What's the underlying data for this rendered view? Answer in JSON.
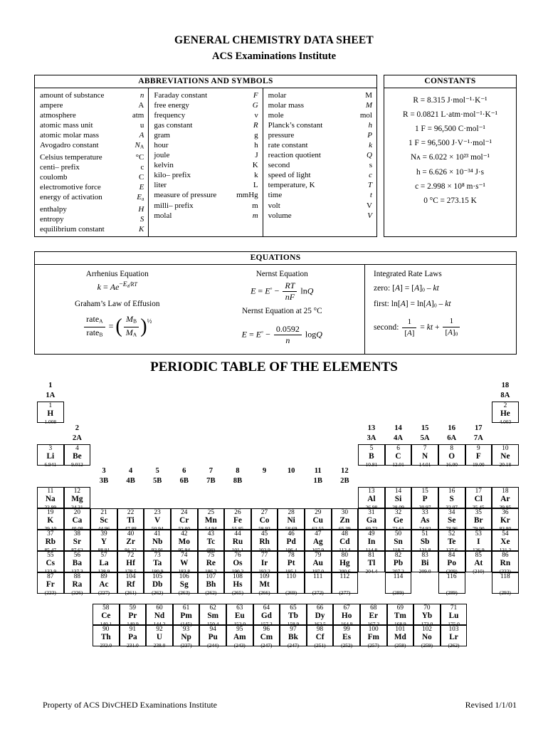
{
  "header": {
    "title": "GENERAL CHEMISTRY DATA SHEET",
    "subtitle": "ACS Examinations Institute"
  },
  "abbreviations": {
    "heading": "ABBREVIATIONS AND SYMBOLS",
    "columns": [
      [
        {
          "name": "amount of substance",
          "symbol": "n",
          "italic": true
        },
        {
          "name": "ampere",
          "symbol": "A",
          "italic": false
        },
        {
          "name": "atmosphere",
          "symbol": "atm",
          "italic": false
        },
        {
          "name": "atomic mass unit",
          "symbol": "u",
          "italic": false
        },
        {
          "name": "atomic molar mass",
          "symbol": "A",
          "italic": true
        },
        {
          "name": "Avogadro constant",
          "symbol": "N",
          "sub": "A",
          "italic": true
        },
        {
          "name": "Celsius temperature",
          "symbol": "°C",
          "italic": false
        },
        {
          "name": "centi– prefix",
          "symbol": "c",
          "italic": false
        },
        {
          "name": "coulomb",
          "symbol": "C",
          "italic": false
        },
        {
          "name": "electromotive force",
          "symbol": "E",
          "italic": true
        },
        {
          "name": "energy of activation",
          "symbol": "E",
          "sub": "a",
          "italic": true
        },
        {
          "name": "enthalpy",
          "symbol": "H",
          "italic": true
        },
        {
          "name": "entropy",
          "symbol": "S",
          "italic": true
        },
        {
          "name": "equilibrium constant",
          "symbol": "K",
          "italic": true
        }
      ],
      [
        {
          "name": "Faraday constant",
          "symbol": "F",
          "italic": true
        },
        {
          "name": "free energy",
          "symbol": "G",
          "italic": true
        },
        {
          "name": "frequency",
          "symbol": "ν",
          "italic": false
        },
        {
          "name": "gas constant",
          "symbol": "R",
          "italic": true
        },
        {
          "name": "gram",
          "symbol": "g",
          "italic": false
        },
        {
          "name": "hour",
          "symbol": "h",
          "italic": false
        },
        {
          "name": "joule",
          "symbol": "J",
          "italic": false
        },
        {
          "name": "kelvin",
          "symbol": "K",
          "italic": false
        },
        {
          "name": "kilo– prefix",
          "symbol": "k",
          "italic": false
        },
        {
          "name": "liter",
          "symbol": "L",
          "italic": false
        },
        {
          "name": "measure of pressure",
          "symbol": "mmHg",
          "italic": false
        },
        {
          "name": "milli– prefix",
          "symbol": "m",
          "italic": false
        },
        {
          "name": "molal",
          "symbol": "m",
          "italic": true
        }
      ],
      [
        {
          "name": "molar",
          "symbol": "M",
          "italic": false
        },
        {
          "name": "molar mass",
          "symbol": "M",
          "italic": true
        },
        {
          "name": "mole",
          "symbol": "mol",
          "italic": false
        },
        {
          "name": "Planck’s constant",
          "symbol": "h",
          "italic": true
        },
        {
          "name": "pressure",
          "symbol": "P",
          "italic": true
        },
        {
          "name": "rate constant",
          "symbol": "k",
          "italic": true
        },
        {
          "name": "reaction quotient",
          "symbol": "Q",
          "italic": true
        },
        {
          "name": "second",
          "symbol": "s",
          "italic": false
        },
        {
          "name": "speed of light",
          "symbol": "c",
          "italic": true
        },
        {
          "name": "temperature, K",
          "symbol": "T",
          "italic": true
        },
        {
          "name": "time",
          "symbol": "t",
          "italic": true
        },
        {
          "name": "volt",
          "symbol": "V",
          "italic": false
        },
        {
          "name": "volume",
          "symbol": "V",
          "italic": true
        }
      ]
    ]
  },
  "constants": {
    "heading": "CONSTANTS",
    "lines": [
      "R = 8.315 J·mol⁻¹·K⁻¹",
      "R = 0.0821 L·atm·mol⁻¹·K⁻¹",
      "1 F = 96,500 C·mol⁻¹",
      "1 F = 96,500 J·V⁻¹·mol⁻¹",
      "Nᴀ = 6.022 × 10²³ mol⁻¹",
      "h = 6.626 × 10⁻³⁴ J·s",
      "c = 2.998 × 10⁸ m·s⁻¹",
      "0 °C = 273.15 K"
    ]
  },
  "equations": {
    "heading": "EQUATIONS",
    "arrhenius_label": "Arrhenius Equation",
    "arrhenius_formula": "k = Ae^(-Ea/RT)",
    "grahams_label": "Graham’s Law of Effusion",
    "grahams_formula": "rateA/rateB = (MB/MA)^(1/2)",
    "nernst_label": "Nernst Equation",
    "nernst_formula": "E = E° - (RT/nF) ln Q",
    "nernst25_label": "Nernst Equation at 25 °C",
    "nernst25_formula": "E = E° - (0.0592/n) log Q",
    "rate_laws_label": "Integrated Rate Laws",
    "rate_zero": "zero:  [A] = [A]₀ – kt",
    "rate_first": "first:  ln[A] = ln[A]₀ – kt",
    "rate_second": "second:  1/[A] = kt + 1/[A]₀",
    "rate_zero_prefix": "zero:",
    "rate_first_prefix": "first:",
    "rate_second_prefix": "second:"
  },
  "periodic_table": {
    "title": "PERIODIC TABLE OF THE ELEMENTS",
    "group_labels": [
      {
        "num": "1",
        "letter": "1A"
      },
      {
        "num": "2",
        "letter": "2A"
      },
      {
        "num": "3",
        "letter": "3B"
      },
      {
        "num": "4",
        "letter": "4B"
      },
      {
        "num": "5",
        "letter": "5B"
      },
      {
        "num": "6",
        "letter": "6B"
      },
      {
        "num": "7",
        "letter": "7B"
      },
      {
        "num": "8",
        "letter": "8B"
      },
      {
        "num": "9",
        "letter": ""
      },
      {
        "num": "10",
        "letter": ""
      },
      {
        "num": "11",
        "letter": "1B"
      },
      {
        "num": "12",
        "letter": "2B"
      },
      {
        "num": "13",
        "letter": "3A"
      },
      {
        "num": "14",
        "letter": "4A"
      },
      {
        "num": "15",
        "letter": "5A"
      },
      {
        "num": "16",
        "letter": "6A"
      },
      {
        "num": "17",
        "letter": "7A"
      },
      {
        "num": "18",
        "letter": "8A"
      }
    ],
    "elements": {
      "H": {
        "z": "1",
        "sym": "H",
        "mass": "1.008"
      },
      "He": {
        "z": "2",
        "sym": "He",
        "mass": "4.003"
      },
      "Li": {
        "z": "3",
        "sym": "Li",
        "mass": "6.941"
      },
      "Be": {
        "z": "4",
        "sym": "Be",
        "mass": "9.012"
      },
      "B": {
        "z": "5",
        "sym": "B",
        "mass": "10.81"
      },
      "C": {
        "z": "6",
        "sym": "C",
        "mass": "12.01"
      },
      "N": {
        "z": "7",
        "sym": "N",
        "mass": "14.01"
      },
      "O": {
        "z": "8",
        "sym": "O",
        "mass": "16.00"
      },
      "F": {
        "z": "9",
        "sym": "F",
        "mass": "19.00"
      },
      "Ne": {
        "z": "10",
        "sym": "Ne",
        "mass": "20.18"
      },
      "Na": {
        "z": "11",
        "sym": "Na",
        "mass": "22.99"
      },
      "Mg": {
        "z": "12",
        "sym": "Mg",
        "mass": "24.31"
      },
      "Al": {
        "z": "13",
        "sym": "Al",
        "mass": "26.98"
      },
      "Si": {
        "z": "14",
        "sym": "Si",
        "mass": "28.09"
      },
      "P": {
        "z": "15",
        "sym": "P",
        "mass": "30.97"
      },
      "S": {
        "z": "16",
        "sym": "S",
        "mass": "32.07"
      },
      "Cl": {
        "z": "17",
        "sym": "Cl",
        "mass": "35.45"
      },
      "Ar": {
        "z": "18",
        "sym": "Ar",
        "mass": "39.95"
      },
      "K": {
        "z": "19",
        "sym": "K",
        "mass": "39.10"
      },
      "Ca": {
        "z": "20",
        "sym": "Ca",
        "mass": "40.08"
      },
      "Sc": {
        "z": "21",
        "sym": "Sc",
        "mass": "44.96"
      },
      "Ti": {
        "z": "22",
        "sym": "Ti",
        "mass": "47.88"
      },
      "V": {
        "z": "23",
        "sym": "V",
        "mass": "50.94"
      },
      "Cr": {
        "z": "24",
        "sym": "Cr",
        "mass": "52.00"
      },
      "Mn": {
        "z": "25",
        "sym": "Mn",
        "mass": "54.94"
      },
      "Fe": {
        "z": "26",
        "sym": "Fe",
        "mass": "55.85"
      },
      "Co": {
        "z": "27",
        "sym": "Co",
        "mass": "58.93"
      },
      "Ni": {
        "z": "28",
        "sym": "Ni",
        "mass": "58.69"
      },
      "Cu": {
        "z": "29",
        "sym": "Cu",
        "mass": "63.55"
      },
      "Zn": {
        "z": "30",
        "sym": "Zn",
        "mass": "65.39"
      },
      "Ga": {
        "z": "31",
        "sym": "Ga",
        "mass": "69.72"
      },
      "Ge": {
        "z": "32",
        "sym": "Ge",
        "mass": "72.61"
      },
      "As": {
        "z": "33",
        "sym": "As",
        "mass": "74.92"
      },
      "Se": {
        "z": "34",
        "sym": "Se",
        "mass": "78.96"
      },
      "Br": {
        "z": "35",
        "sym": "Br",
        "mass": "79.90"
      },
      "Kr": {
        "z": "36",
        "sym": "Kr",
        "mass": "83.80"
      },
      "Rb": {
        "z": "37",
        "sym": "Rb",
        "mass": "85.47"
      },
      "Sr": {
        "z": "38",
        "sym": "Sr",
        "mass": "87.62"
      },
      "Y": {
        "z": "39",
        "sym": "Y",
        "mass": "88.91"
      },
      "Zr": {
        "z": "40",
        "sym": "Zr",
        "mass": "91.22"
      },
      "Nb": {
        "z": "41",
        "sym": "Nb",
        "mass": "92.91"
      },
      "Mo": {
        "z": "42",
        "sym": "Mo",
        "mass": "95.94"
      },
      "Tc": {
        "z": "43",
        "sym": "Tc",
        "mass": "(98)"
      },
      "Ru": {
        "z": "44",
        "sym": "Ru",
        "mass": "101.1"
      },
      "Rh": {
        "z": "45",
        "sym": "Rh",
        "mass": "102.9"
      },
      "Pd": {
        "z": "46",
        "sym": "Pd",
        "mass": "106.4"
      },
      "Ag": {
        "z": "47",
        "sym": "Ag",
        "mass": "107.9"
      },
      "Cd": {
        "z": "48",
        "sym": "Cd",
        "mass": "112.4"
      },
      "In": {
        "z": "49",
        "sym": "In",
        "mass": "114.8"
      },
      "Sn": {
        "z": "50",
        "sym": "Sn",
        "mass": "118.7"
      },
      "Sb": {
        "z": "51",
        "sym": "Sb",
        "mass": "121.8"
      },
      "Te": {
        "z": "52",
        "sym": "Te",
        "mass": "127.6"
      },
      "I": {
        "z": "53",
        "sym": "I",
        "mass": "126.9"
      },
      "Xe": {
        "z": "54",
        "sym": "Xe",
        "mass": "131.3"
      },
      "Cs": {
        "z": "55",
        "sym": "Cs",
        "mass": "132.9"
      },
      "Ba": {
        "z": "56",
        "sym": "Ba",
        "mass": "137.3"
      },
      "La": {
        "z": "57",
        "sym": "La",
        "mass": "138.9"
      },
      "Hf": {
        "z": "72",
        "sym": "Hf",
        "mass": "178.5"
      },
      "Ta": {
        "z": "73",
        "sym": "Ta",
        "mass": "180.9"
      },
      "W": {
        "z": "74",
        "sym": "W",
        "mass": "183.8"
      },
      "Re": {
        "z": "75",
        "sym": "Re",
        "mass": "186.2"
      },
      "Os": {
        "z": "76",
        "sym": "Os",
        "mass": "190.2"
      },
      "Ir": {
        "z": "77",
        "sym": "Ir",
        "mass": "192.2"
      },
      "Pt": {
        "z": "78",
        "sym": "Pt",
        "mass": "195.1"
      },
      "Au": {
        "z": "79",
        "sym": "Au",
        "mass": "197.0"
      },
      "Hg": {
        "z": "80",
        "sym": "Hg",
        "mass": "200.6"
      },
      "Tl": {
        "z": "81",
        "sym": "Tl",
        "mass": "204.4"
      },
      "Pb": {
        "z": "82",
        "sym": "Pb",
        "mass": "207.2"
      },
      "Bi": {
        "z": "83",
        "sym": "Bi",
        "mass": "209.0"
      },
      "Po": {
        "z": "84",
        "sym": "Po",
        "mass": "(209)"
      },
      "At": {
        "z": "85",
        "sym": "At",
        "mass": "(210)"
      },
      "Rn": {
        "z": "86",
        "sym": "Rn",
        "mass": "(222)"
      },
      "Fr": {
        "z": "87",
        "sym": "Fr",
        "mass": "(223)"
      },
      "Ra": {
        "z": "88",
        "sym": "Ra",
        "mass": "(226)"
      },
      "Ac": {
        "z": "89",
        "sym": "Ac",
        "mass": "(227)"
      },
      "Rf": {
        "z": "104",
        "sym": "Rf",
        "mass": "(261)"
      },
      "Db": {
        "z": "105",
        "sym": "Db",
        "mass": "(262)"
      },
      "Sg": {
        "z": "106",
        "sym": "Sg",
        "mass": "(263)"
      },
      "Bh": {
        "z": "107",
        "sym": "Bh",
        "mass": "(262)"
      },
      "Hs": {
        "z": "108",
        "sym": "Hs",
        "mass": "(265)"
      },
      "Mt": {
        "z": "109",
        "sym": "Mt",
        "mass": "(266)"
      },
      "E110": {
        "z": "110",
        "sym": "",
        "mass": "(269)"
      },
      "E111": {
        "z": "111",
        "sym": "",
        "mass": "(272)"
      },
      "E112": {
        "z": "112",
        "sym": "",
        "mass": "(277)"
      },
      "E114": {
        "z": "114",
        "sym": "",
        "mass": "(289)"
      },
      "E116": {
        "z": "116",
        "sym": "",
        "mass": "(289)"
      },
      "E118": {
        "z": "118",
        "sym": "",
        "mass": "(293)"
      },
      "Ce": {
        "z": "58",
        "sym": "Ce",
        "mass": "140.1"
      },
      "Pr": {
        "z": "59",
        "sym": "Pr",
        "mass": "140.9"
      },
      "Nd": {
        "z": "60",
        "sym": "Nd",
        "mass": "144.2"
      },
      "Pm": {
        "z": "61",
        "sym": "Pm",
        "mass": "(145)"
      },
      "Sm": {
        "z": "62",
        "sym": "Sm",
        "mass": "150.4"
      },
      "Eu": {
        "z": "63",
        "sym": "Eu",
        "mass": "152.0"
      },
      "Gd": {
        "z": "64",
        "sym": "Gd",
        "mass": "157.3"
      },
      "Tb": {
        "z": "65",
        "sym": "Tb",
        "mass": "158.9"
      },
      "Dy": {
        "z": "66",
        "sym": "Dy",
        "mass": "162.5"
      },
      "Ho": {
        "z": "67",
        "sym": "Ho",
        "mass": "164.9"
      },
      "Er": {
        "z": "68",
        "sym": "Er",
        "mass": "167.3"
      },
      "Tm": {
        "z": "69",
        "sym": "Tm",
        "mass": "168.9"
      },
      "Yb": {
        "z": "70",
        "sym": "Yb",
        "mass": "173.0"
      },
      "Lu": {
        "z": "71",
        "sym": "Lu",
        "mass": "175.0"
      },
      "Th": {
        "z": "90",
        "sym": "Th",
        "mass": "232.0"
      },
      "Pa": {
        "z": "91",
        "sym": "Pa",
        "mass": "231.0"
      },
      "U": {
        "z": "92",
        "sym": "U",
        "mass": "238.0"
      },
      "Np": {
        "z": "93",
        "sym": "Np",
        "mass": "(237)"
      },
      "Pu": {
        "z": "94",
        "sym": "Pu",
        "mass": "(244)"
      },
      "Am": {
        "z": "95",
        "sym": "Am",
        "mass": "(243)"
      },
      "Cm": {
        "z": "96",
        "sym": "Cm",
        "mass": "(247)"
      },
      "Bk": {
        "z": "97",
        "sym": "Bk",
        "mass": "(247)"
      },
      "Cf": {
        "z": "98",
        "sym": "Cf",
        "mass": "(251)"
      },
      "Es": {
        "z": "99",
        "sym": "Es",
        "mass": "(252)"
      },
      "Fm": {
        "z": "100",
        "sym": "Fm",
        "mass": "(257)"
      },
      "Md": {
        "z": "101",
        "sym": "Md",
        "mass": "(258)"
      },
      "No": {
        "z": "102",
        "sym": "No",
        "mass": "(259)"
      },
      "Lr": {
        "z": "103",
        "sym": "Lr",
        "mass": "(262)"
      }
    }
  },
  "footer": {
    "left": "Property of ACS DivCHED Examinations Institute",
    "right": "Revised 1/1/01"
  }
}
